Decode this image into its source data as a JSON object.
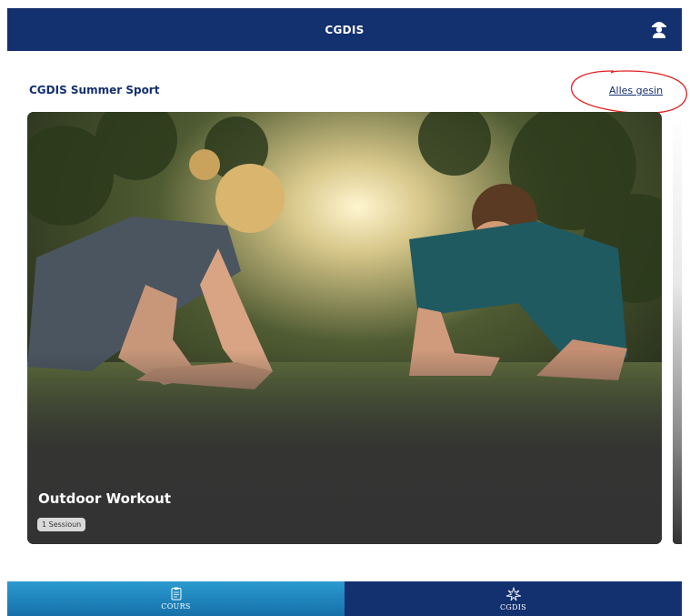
{
  "header": {
    "title": "CGDIS",
    "profile_icon": "firefighter-icon"
  },
  "section": {
    "title": "CGDIS Summer Sport",
    "see_all_label": "Alles gesin"
  },
  "card": {
    "title": "Outdoor Workout",
    "badge": "1 Sessioun",
    "image_description": "Two people doing plank exercise on grass outdoors"
  },
  "bottom_nav": {
    "items": [
      {
        "label": "COURS",
        "icon": "clipboard-icon",
        "active": true
      },
      {
        "label": "CGDIS",
        "icon": "cgdis-logo-icon",
        "active": false
      }
    ]
  },
  "colors": {
    "primary": "#13306f",
    "accent": "#2b9bd0",
    "annotation": "#e02020"
  }
}
